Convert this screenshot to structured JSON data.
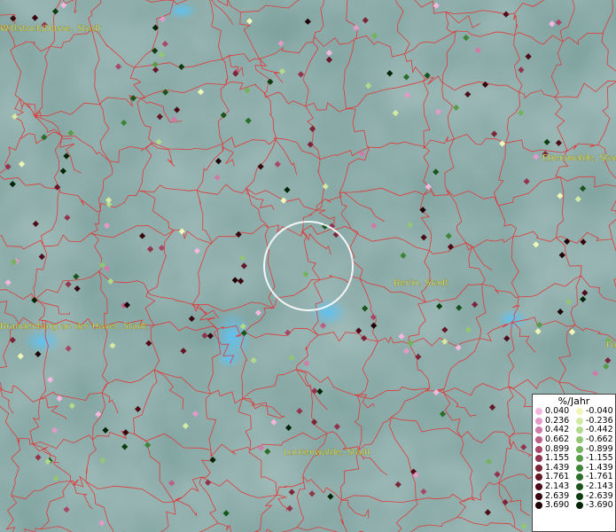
{
  "map": {
    "city_labels": [
      {
        "id": "wittstock",
        "text": "Wittstock/Dosse, Stadt"
      },
      {
        "id": "eberswalde",
        "text": "Eberswalde, Stadt"
      },
      {
        "id": "berlin",
        "text": "Berlin, Stadt"
      },
      {
        "id": "brandenburg",
        "text": "Brandenburg an der Havel, Stadt"
      },
      {
        "id": "luckenwalde",
        "text": "Luckenwalde, Stadt"
      },
      {
        "id": "fu",
        "text": "Fü"
      }
    ],
    "colors": {
      "background": "#7fa3a0",
      "boundaries": "#e03a3a",
      "label": "#ffff33",
      "water": "#4fb3e8",
      "selection_circle": "#ffffff"
    }
  },
  "legend": {
    "title": "%/Jahr",
    "positive": [
      {
        "label": "0.040",
        "color": "#f4b8df"
      },
      {
        "label": "0.236",
        "color": "#e49ac8"
      },
      {
        "label": "0.442",
        "color": "#d07aa8"
      },
      {
        "label": "0.662",
        "color": "#bd5e86"
      },
      {
        "label": "0.899",
        "color": "#a84766"
      },
      {
        "label": "1.155",
        "color": "#93344e"
      },
      {
        "label": "1.439",
        "color": "#7c2438"
      },
      {
        "label": "1.761",
        "color": "#661726"
      },
      {
        "label": "2.143",
        "color": "#4e0c18"
      },
      {
        "label": "2.639",
        "color": "#37060e"
      },
      {
        "label": "3.690",
        "color": "#1e0206"
      }
    ],
    "negative": [
      {
        "label": "-0.040",
        "color": "#f0f7b8"
      },
      {
        "label": "-0.236",
        "color": "#d4eaa2"
      },
      {
        "label": "-0.442",
        "color": "#b3d98a"
      },
      {
        "label": "-0.662",
        "color": "#92c674"
      },
      {
        "label": "-0.899",
        "color": "#74b25e"
      },
      {
        "label": "-1.155",
        "color": "#589c4a"
      },
      {
        "label": "-1.439",
        "color": "#3f8538"
      },
      {
        "label": "-1.761",
        "color": "#2a6d28"
      },
      {
        "label": "-2.143",
        "color": "#19551b"
      },
      {
        "label": "-2.639",
        "color": "#0c3d10"
      },
      {
        "label": "-3.690",
        "color": "#042407"
      }
    ]
  }
}
